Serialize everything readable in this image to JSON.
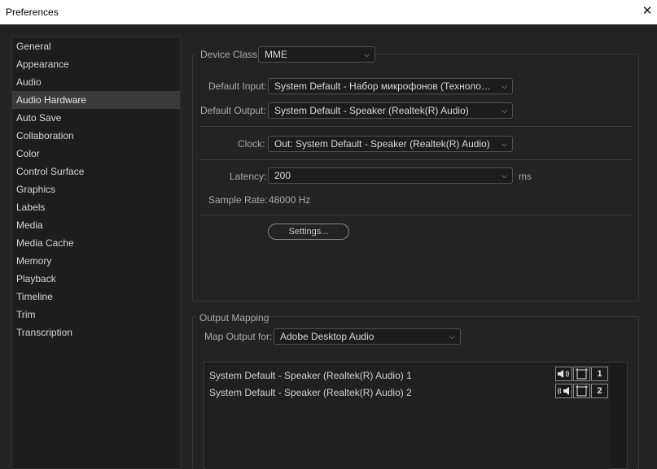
{
  "window": {
    "title": "Preferences",
    "close_label": "✕"
  },
  "sidebar": {
    "items": [
      {
        "label": "General"
      },
      {
        "label": "Appearance"
      },
      {
        "label": "Audio"
      },
      {
        "label": "Audio Hardware",
        "active": true
      },
      {
        "label": "Auto Save"
      },
      {
        "label": "Collaboration"
      },
      {
        "label": "Color"
      },
      {
        "label": "Control Surface"
      },
      {
        "label": "Graphics"
      },
      {
        "label": "Labels"
      },
      {
        "label": "Media"
      },
      {
        "label": "Media Cache"
      },
      {
        "label": "Memory"
      },
      {
        "label": "Playback"
      },
      {
        "label": "Timeline"
      },
      {
        "label": "Trim"
      },
      {
        "label": "Transcription"
      }
    ]
  },
  "device": {
    "class_label": "Device Class:",
    "class_value": "MME",
    "input_label": "Default Input:",
    "input_value": "System Default - Набор микрофонов (Технология In...",
    "output_label": "Default Output:",
    "output_value": "System Default - Speaker (Realtek(R) Audio)",
    "clock_label": "Clock:",
    "clock_value": "Out: System Default - Speaker (Realtek(R) Audio)",
    "latency_label": "Latency:",
    "latency_value": "200",
    "latency_unit": "ms",
    "sample_rate_label": "Sample Rate:",
    "sample_rate_value": "48000 Hz",
    "settings_button": "Settings..."
  },
  "output_mapping": {
    "section_label": "Output Mapping",
    "map_label": "Map Output for:",
    "map_value": "Adobe Desktop Audio",
    "channels": [
      {
        "label": "System Default - Speaker (Realtek(R) Audio) 1",
        "number": "1"
      },
      {
        "label": "System Default - Speaker (Realtek(R) Audio) 2",
        "number": "2"
      }
    ]
  },
  "icons": {
    "dropdown": "chevron-down-icon",
    "speaker_left": "speaker-left-icon",
    "speaker_right": "speaker-right-icon",
    "channel_frame": "frame-icon"
  }
}
